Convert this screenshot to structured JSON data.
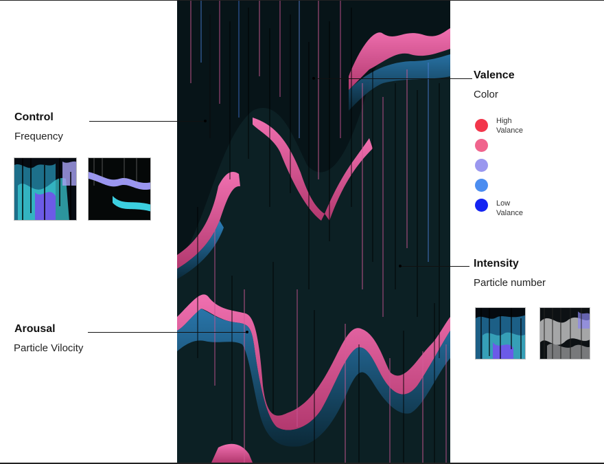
{
  "control": {
    "title": "Control",
    "subtitle": "Frequency",
    "thumb_captions": [
      "",
      ""
    ]
  },
  "arousal": {
    "title": "Arousal",
    "subtitle": "Particle Vilocity"
  },
  "valence": {
    "title": "Valence",
    "subtitle": "Color",
    "legend": [
      {
        "color": "#f2364b",
        "label": "High\nValance"
      },
      {
        "color": "#f0648d",
        "label": ""
      },
      {
        "color": "#9a97ef",
        "label": ""
      },
      {
        "color": "#4c8df0",
        "label": ""
      },
      {
        "color": "#1424f2",
        "label": "Low\nValance"
      }
    ]
  },
  "intensity": {
    "title": "Intensity",
    "subtitle": "Particle number",
    "thumb_captions": [
      "",
      ""
    ]
  },
  "colors": {
    "pink": "#e5609a",
    "blue": "#2f7fb8",
    "background": "#071418"
  }
}
